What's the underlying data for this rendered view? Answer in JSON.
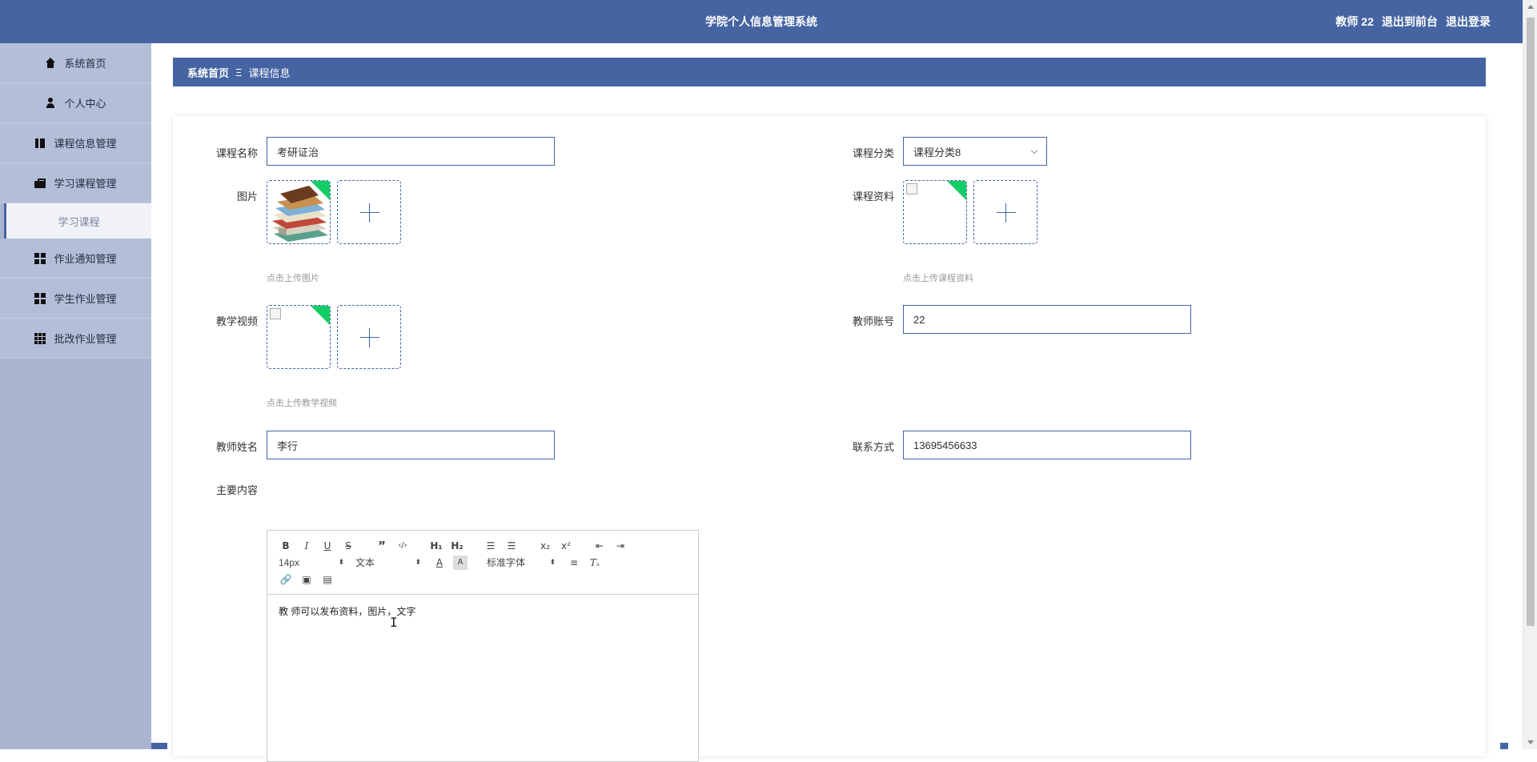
{
  "header": {
    "title": "学院个人信息管理系统",
    "user": "教师 22",
    "to_front": "退出到前台",
    "logout": "退出登录"
  },
  "sidebar": {
    "items": [
      {
        "label": "系统首页",
        "icon": "home-icon"
      },
      {
        "label": "个人中心",
        "icon": "user-icon"
      },
      {
        "label": "课程信息管理",
        "icon": "book-icon"
      },
      {
        "label": "学习课程管理",
        "icon": "briefcase-icon"
      },
      {
        "label": "学习课程",
        "icon": ""
      },
      {
        "label": "作业通知管理",
        "icon": "grid-icon"
      },
      {
        "label": "学生作业管理",
        "icon": "grid-icon"
      },
      {
        "label": "批改作业管理",
        "icon": "grid9-icon"
      }
    ]
  },
  "breadcrumb": {
    "home": "系统首页",
    "separator": "Ξ",
    "current": "课程信息"
  },
  "form": {
    "course_name": {
      "label": "课程名称",
      "value": "考研证治"
    },
    "course_category": {
      "label": "课程分类",
      "value": "课程分类8"
    },
    "picture": {
      "label": "图片",
      "hint": "点击上传图片"
    },
    "course_material": {
      "label": "课程资料",
      "hint": "点击上传课程资料"
    },
    "teaching_video": {
      "label": "教学视频",
      "hint": "点击上传教学视频"
    },
    "teacher_account": {
      "label": "教师账号",
      "value": "22"
    },
    "teacher_name": {
      "label": "教师姓名",
      "value": "李行"
    },
    "contact": {
      "label": "联系方式",
      "value": "13695456633"
    },
    "main_content": {
      "label": "主要内容"
    }
  },
  "editor": {
    "font_size": "14px",
    "text_type": "文本",
    "font_family": "标准字体",
    "content": "教 师可以发布资料，图片，文字"
  },
  "colors": {
    "primary": "#4664a2",
    "sidebar_bg": "#a9b4d1",
    "upload_corner": "#13ce66"
  }
}
